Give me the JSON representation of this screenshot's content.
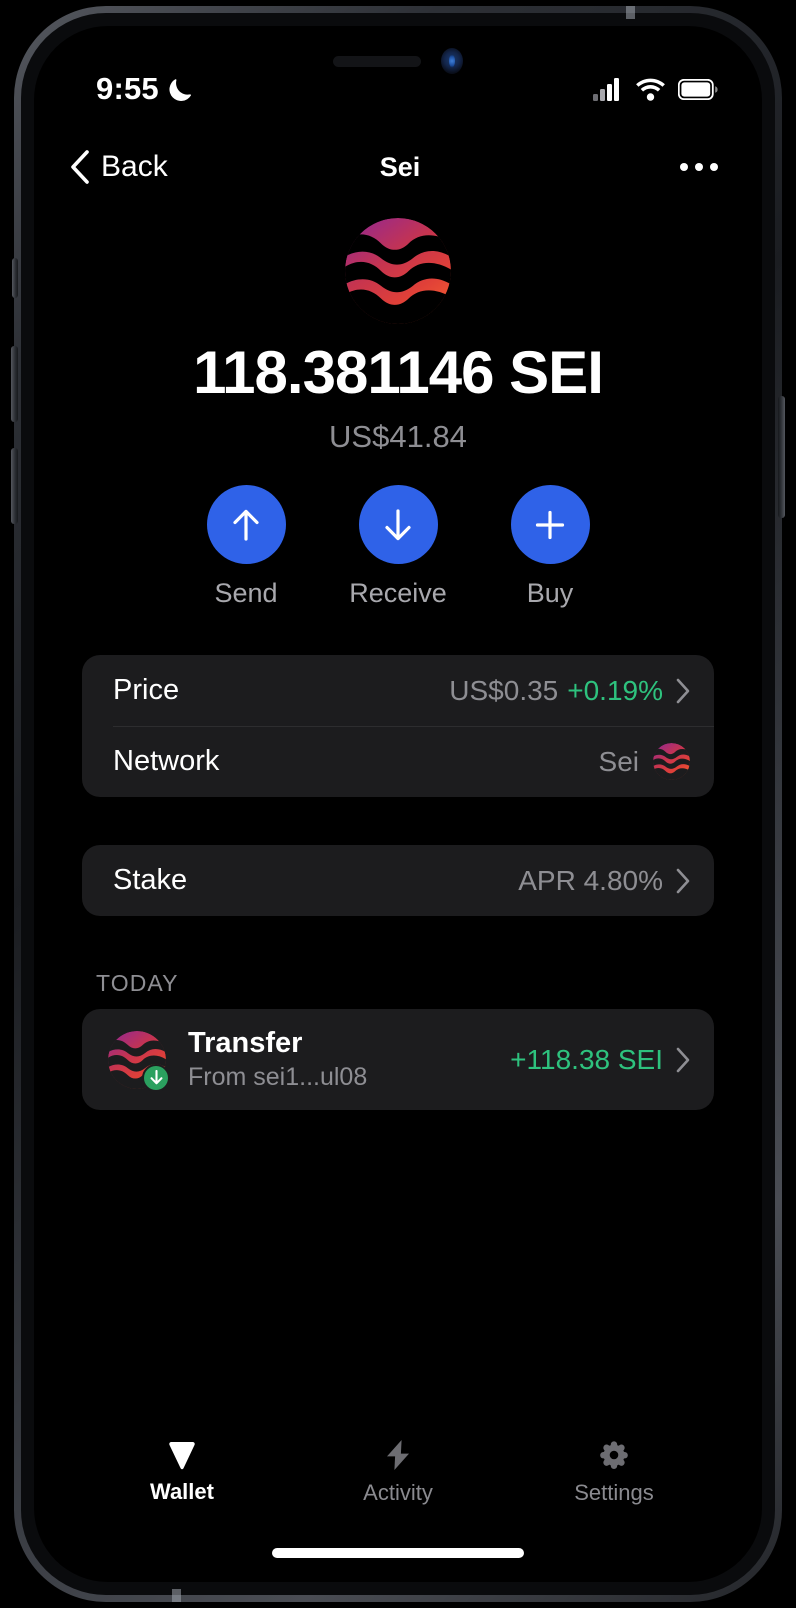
{
  "status_bar": {
    "time": "9:55",
    "dnd_icon": "moon-icon",
    "cellular_icon": "signal-bars-icon",
    "wifi_icon": "wifi-icon",
    "battery_icon": "battery-icon"
  },
  "nav": {
    "back_label": "Back",
    "title": "Sei",
    "back_icon": "chevron-left-icon",
    "more_icon": "ellipsis-icon"
  },
  "token": {
    "logo_icon": "sei-logo-icon",
    "balance": "118.381146 SEI",
    "fiat_value": "US$41.84"
  },
  "actions": [
    {
      "label": "Send",
      "icon": "arrow-up-icon"
    },
    {
      "label": "Receive",
      "icon": "arrow-down-icon"
    },
    {
      "label": "Buy",
      "icon": "plus-icon"
    }
  ],
  "info_rows": [
    {
      "label": "Price",
      "value": "US$0.35",
      "change": "+0.19%",
      "chevron_icon": "chevron-right-icon"
    },
    {
      "label": "Network",
      "value": "Sei",
      "network_icon": "sei-logo-icon"
    }
  ],
  "stake_row": {
    "label": "Stake",
    "value": "APR 4.80%",
    "chevron_icon": "chevron-right-icon"
  },
  "transactions": {
    "section_label": "TODAY",
    "items": [
      {
        "icon": "sei-logo-icon",
        "badge_icon": "arrow-down-badge-icon",
        "title": "Transfer",
        "subtitle": "From sei1...ul08",
        "amount": "+118.38 SEI",
        "chevron_icon": "chevron-right-icon"
      }
    ]
  },
  "tabs": [
    {
      "label": "Wallet",
      "icon": "diamond-icon",
      "active": true
    },
    {
      "label": "Activity",
      "icon": "lightning-bolt-icon",
      "active": false
    },
    {
      "label": "Settings",
      "icon": "gear-icon",
      "active": false
    }
  ],
  "colors": {
    "accent_blue": "#2f62e8",
    "positive_green": "#2ec27e",
    "badge_green": "#2ba05f",
    "card_bg": "#1c1c1e",
    "screen_bg": "#000000",
    "muted_text": "#8e8e93",
    "logo_gradient_start": "#a02c7e",
    "logo_gradient_end": "#e8453c"
  }
}
